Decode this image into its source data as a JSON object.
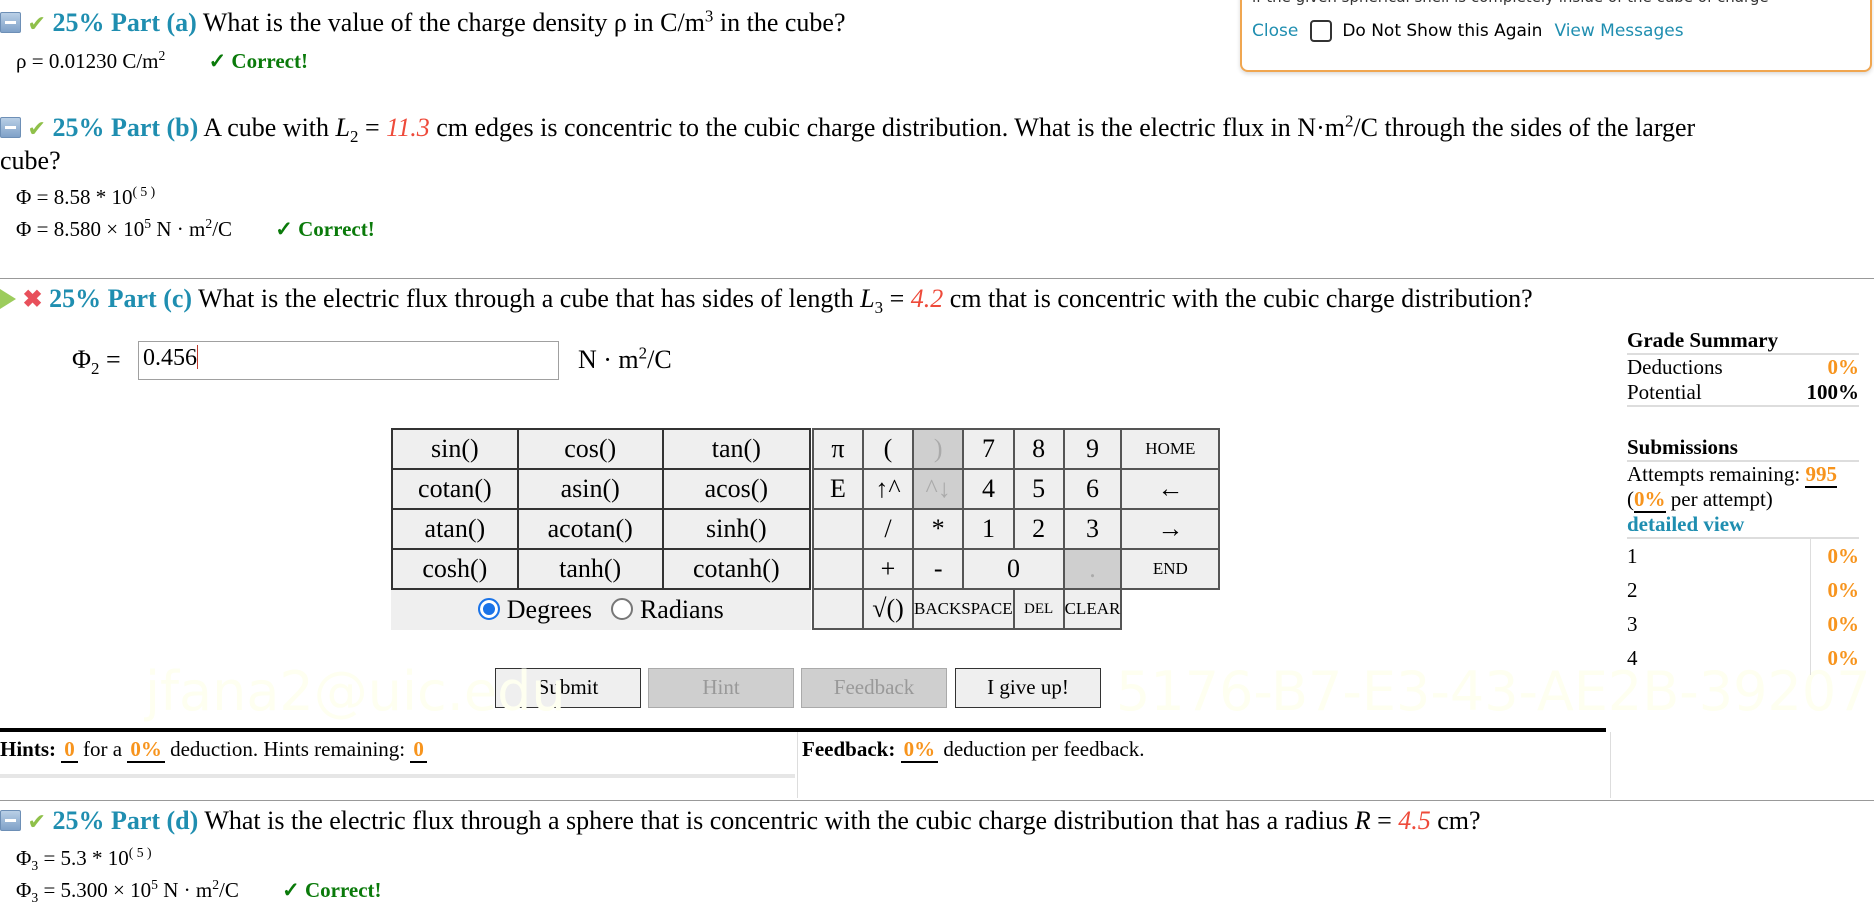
{
  "popup": {
    "clipped_text": "if the given spherical shell is completely inside of the cube of charge",
    "close_label": "Close",
    "do_not_show_label": "Do Not Show this Again",
    "view_messages_label": "View Messages"
  },
  "part_a": {
    "percent": "25%",
    "label": "Part (a)",
    "question_pre": "What is the value of the charge density ρ in C/m",
    "question_sup": "3",
    "question_post": " in the cube?",
    "answer_lhs": "ρ = 0.01230  C/m",
    "answer_sup": "2",
    "status": "✓ Correct!"
  },
  "part_b": {
    "percent": "25%",
    "label": "Part (b)",
    "q1": "A cube with ",
    "var": "L",
    "var_sub": "2",
    "q2": " = ",
    "value": "11.3",
    "q3": " cm edges is concentric to the cubic charge distribution. What is the electric flux in N·m",
    "q3_sup": "2",
    "q4": "/C through the sides of the larger",
    "q5": "cube?",
    "entered_lhs": "Φ = 8.58 * 10",
    "entered_sup": "( 5 )",
    "answer_lhs": "Φ = 8.580 × 10",
    "answer_exp": "5",
    "answer_unit": " N · m",
    "answer_unit_sup": "2",
    "answer_unit_post": "/C",
    "status": "✓ Correct!"
  },
  "part_c": {
    "percent": "25%",
    "label": "Part (c)",
    "q1": "What is the electric flux through a cube that has sides of length ",
    "var": "L",
    "var_sub": "3",
    "q2": " = ",
    "value": "4.2",
    "q3": " cm that is concentric with the cubic charge distribution?",
    "input_label": "Φ",
    "input_label_sub": "2",
    "input_label_eq": " =",
    "input_value": "0.456",
    "unit_pre": "N · m",
    "unit_sup": "2",
    "unit_post": "/C"
  },
  "keypad": {
    "functions": [
      [
        "sin()",
        "cos()",
        "tan()"
      ],
      [
        "cotan()",
        "asin()",
        "acos()"
      ],
      [
        "atan()",
        "acotan()",
        "sinh()"
      ],
      [
        "cosh()",
        "tanh()",
        "cotanh()"
      ]
    ],
    "degrees_label": "Degrees",
    "radians_label": "Radians",
    "angle_mode": "Degrees",
    "keys": {
      "pi": "π",
      "lparen": "(",
      "rparen": ")",
      "k7": "7",
      "k8": "8",
      "k9": "9",
      "home": "HOME",
      "e": "E",
      "up": "↑^",
      "down": "^↓",
      "k4": "4",
      "k5": "5",
      "k6": "6",
      "left": "←",
      "slash": "/",
      "star": "*",
      "k1": "1",
      "k2": "2",
      "k3": "3",
      "right": "→",
      "plus": "+",
      "minus": "-",
      "k0": "0",
      "dot": ".",
      "end": "END",
      "sqrt": "√()",
      "backspace": "BACKSPACE",
      "del": "DEL",
      "clear": "CLEAR"
    }
  },
  "buttons": {
    "submit": "Submit",
    "hint": "Hint",
    "feedback": "Feedback",
    "give_up": "I give up!"
  },
  "hints": {
    "label": "Hints:",
    "count": "0",
    "for_a": " for a ",
    "deduction": "0%",
    "text": " deduction. Hints remaining: ",
    "remaining": "0"
  },
  "feedback": {
    "label": "Feedback:",
    "deduction": "0%",
    "text": " deduction per feedback."
  },
  "grade_summary": {
    "title": "Grade Summary",
    "deductions_label": "Deductions",
    "deductions_value": "0%",
    "potential_label": "Potential",
    "potential_value": "100%"
  },
  "submissions": {
    "title": "Submissions",
    "attempts_label": "Attempts remaining: ",
    "attempts_value": "995",
    "per_attempt_open": "(",
    "per_attempt_value": "0%",
    "per_attempt_text": " per attempt)",
    "detailed_view": "detailed view",
    "rows": [
      {
        "n": "1",
        "v": "0%"
      },
      {
        "n": "2",
        "v": "0%"
      },
      {
        "n": "3",
        "v": "0%"
      },
      {
        "n": "4",
        "v": "0%"
      }
    ]
  },
  "part_d": {
    "percent": "25%",
    "label": "Part (d)",
    "q1": "What is the electric flux through a sphere that is concentric with the cubic charge distribution that has a radius ",
    "var": "R",
    "q2": " = ",
    "value": "4.5",
    "q3": " cm?",
    "entered_lhs": "Φ",
    "entered_sub": "3",
    "entered_rhs": " = 5.3 * 10",
    "entered_sup": "( 5 )",
    "answer_lhs": "Φ",
    "answer_sub": "3",
    "answer_rhs": " = 5.300 × 10",
    "answer_exp": "5",
    "answer_unit": " N · m",
    "answer_unit_sup": "2",
    "answer_unit_post": "/C",
    "status": "✓ Correct!"
  },
  "watermarks": {
    "email": "jfana2@uic.edu",
    "code": "5176-B7-E3-43-AE2B-39207"
  }
}
